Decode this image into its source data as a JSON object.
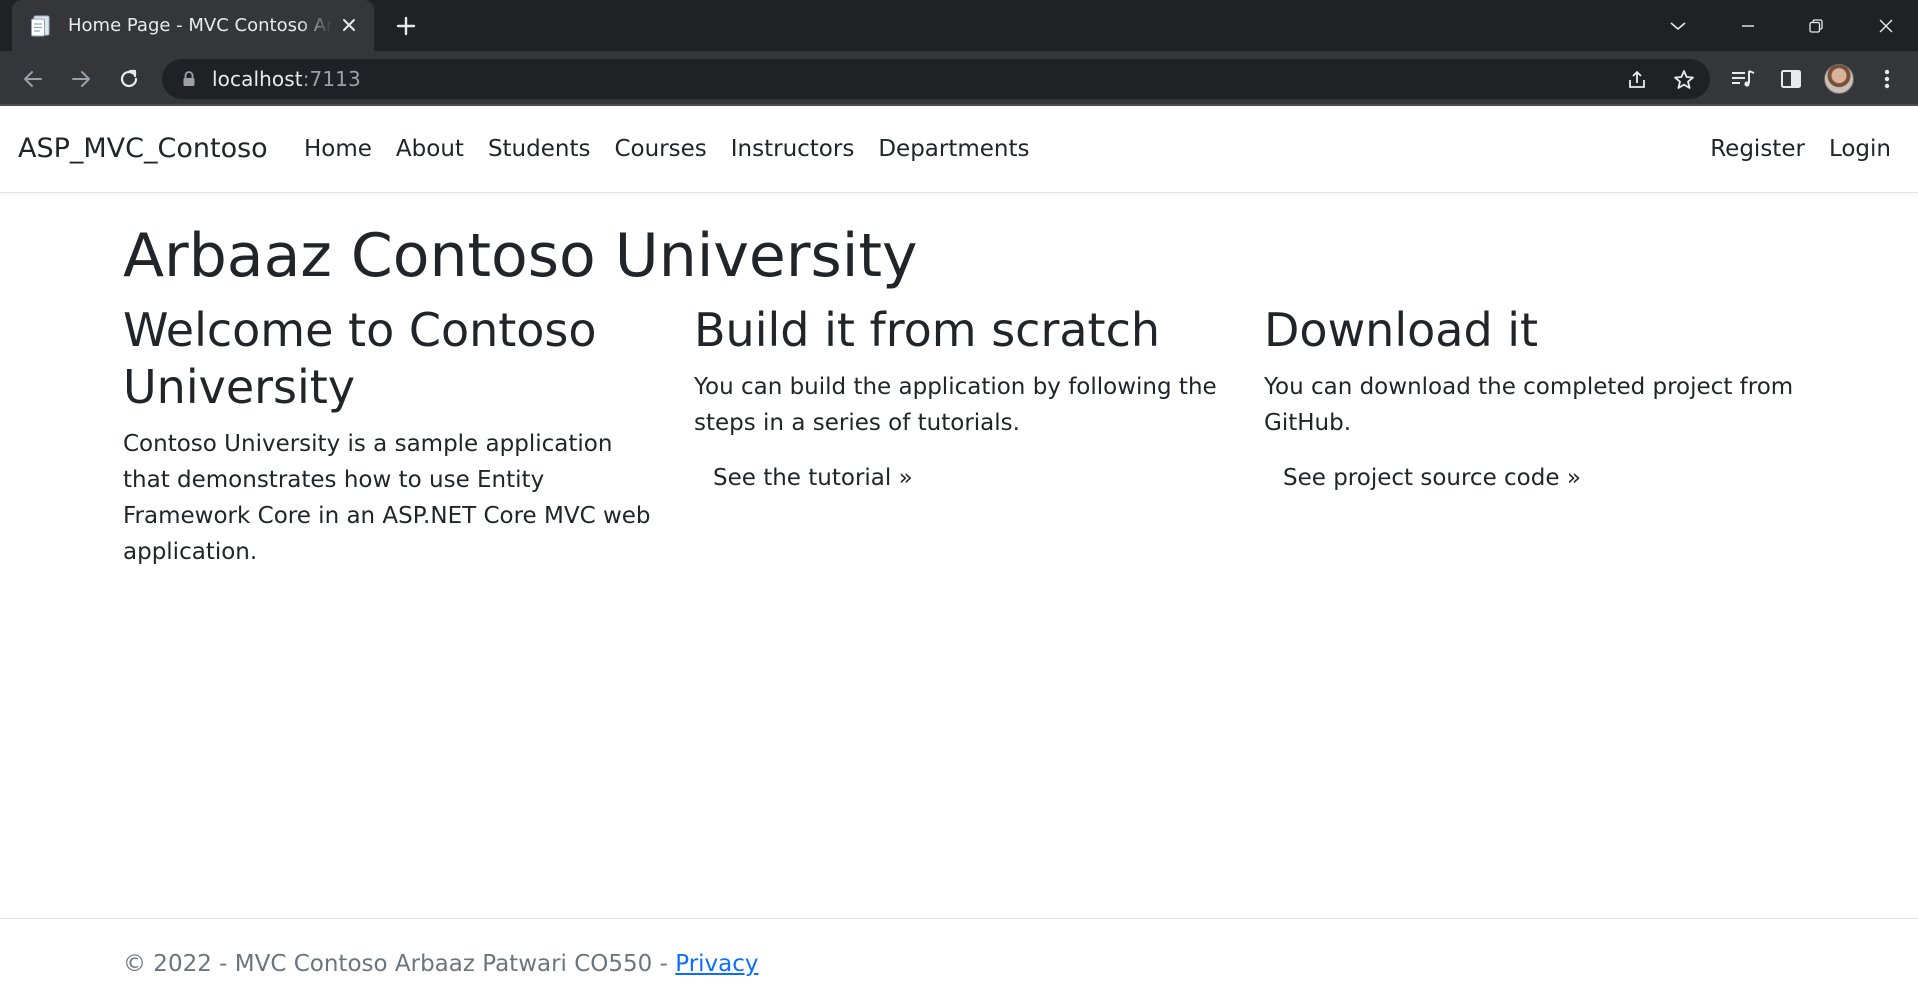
{
  "browser": {
    "tab_title": "Home Page - MVC Contoso Arbaaz Patwari",
    "url_host": "localhost",
    "url_port": ":7113",
    "icons": {
      "favicon": "document-icon",
      "tab_close": "close-icon",
      "new_tab": "plus-icon",
      "tab_search": "chevron-down-icon",
      "minimize": "minimize-icon",
      "restore": "restore-icon",
      "close_window": "close-icon",
      "back": "arrow-left-icon",
      "forward": "arrow-right-icon",
      "reload": "reload-icon",
      "lock": "lock-icon",
      "share": "share-icon",
      "bookmark": "star-icon",
      "media": "media-queue-icon",
      "side_panel": "side-panel-icon",
      "profile": "avatar",
      "menu": "kebab-menu-icon"
    },
    "colors": {
      "frame": "#202124",
      "toolbar": "#35363a",
      "omnibox": "#202124"
    }
  },
  "navbar": {
    "brand": "ASP_MVC_Contoso",
    "links": [
      "Home",
      "About",
      "Students",
      "Courses",
      "Instructors",
      "Departments"
    ],
    "register": "Register",
    "login": "Login"
  },
  "main": {
    "title": "Arbaaz Contoso University",
    "columns": [
      {
        "heading": "Welcome to Contoso University",
        "text": "Contoso University is a sample application that demonstrates how to use Entity Framework Core in an ASP.NET Core MVC web application.",
        "button": ""
      },
      {
        "heading": "Build it from scratch",
        "text": "You can build the application by following the steps in a series of tutorials.",
        "button": "See the tutorial »"
      },
      {
        "heading": "Download it",
        "text": "You can download the completed project from GitHub.",
        "button": "See project source code »"
      }
    ]
  },
  "footer": {
    "text": "© 2022 - MVC Contoso Arbaaz Patwari CO550 - ",
    "privacy_link": "Privacy",
    "link_color": "#0d6efd"
  }
}
